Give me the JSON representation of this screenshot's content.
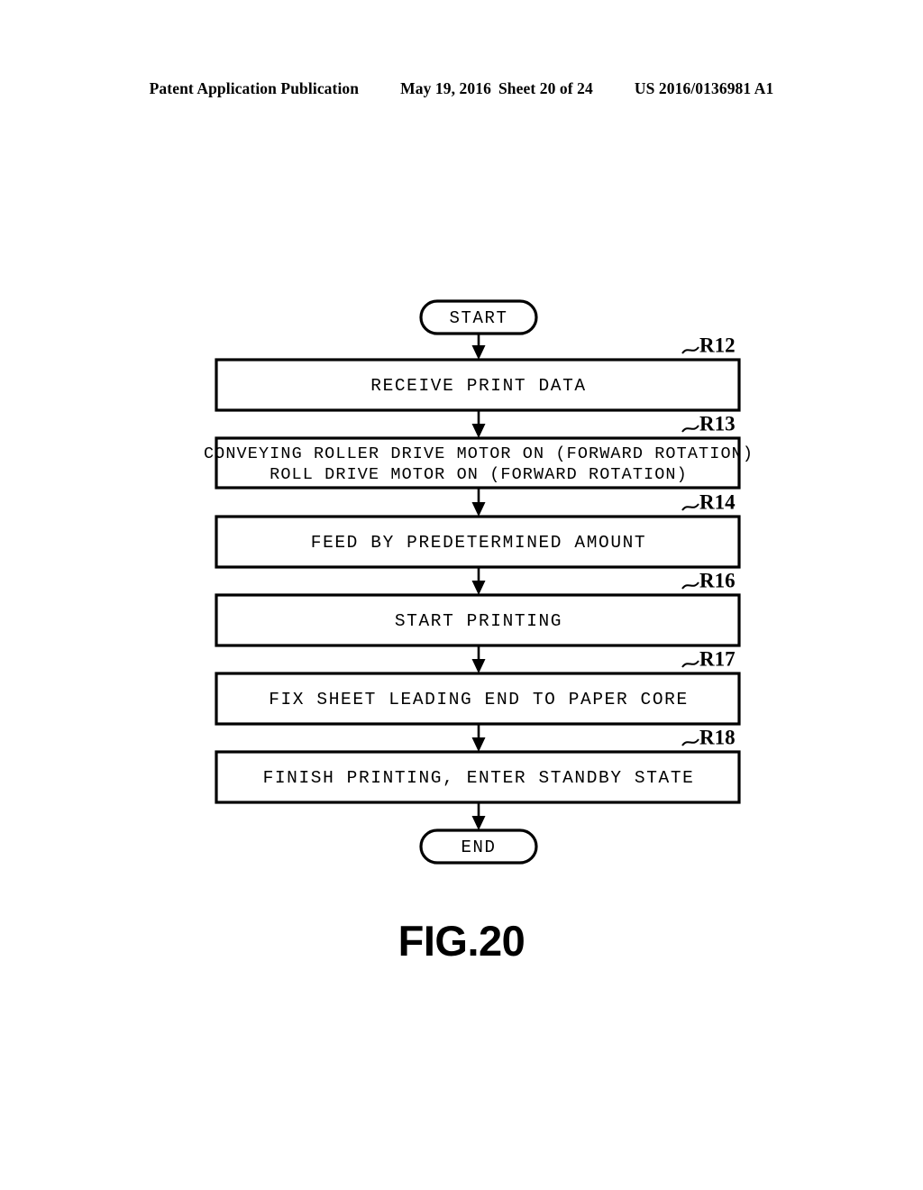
{
  "header": {
    "publication": "Patent Application Publication",
    "date": "May 19, 2016",
    "sheet": "Sheet 20 of 24",
    "number": "US 2016/0136981 A1"
  },
  "figure": {
    "caption": "FIG.20"
  },
  "flowchart": {
    "start_label": "START",
    "end_label": "END",
    "steps": [
      {
        "ref": "R12",
        "lines": [
          "RECEIVE PRINT DATA"
        ]
      },
      {
        "ref": "R13",
        "lines": [
          "CONVEYING ROLLER DRIVE MOTOR ON (FORWARD ROTATION)",
          "ROLL DRIVE MOTOR ON (FORWARD ROTATION)"
        ]
      },
      {
        "ref": "R14",
        "lines": [
          "FEED BY PREDETERMINED AMOUNT"
        ]
      },
      {
        "ref": "R16",
        "lines": [
          "START PRINTING"
        ]
      },
      {
        "ref": "R17",
        "lines": [
          "FIX SHEET LEADING END TO PAPER CORE"
        ]
      },
      {
        "ref": "R18",
        "lines": [
          "FINISH PRINTING, ENTER STANDBY STATE"
        ]
      }
    ]
  },
  "colors": {
    "ink": "#000000",
    "paper": "#ffffff"
  }
}
